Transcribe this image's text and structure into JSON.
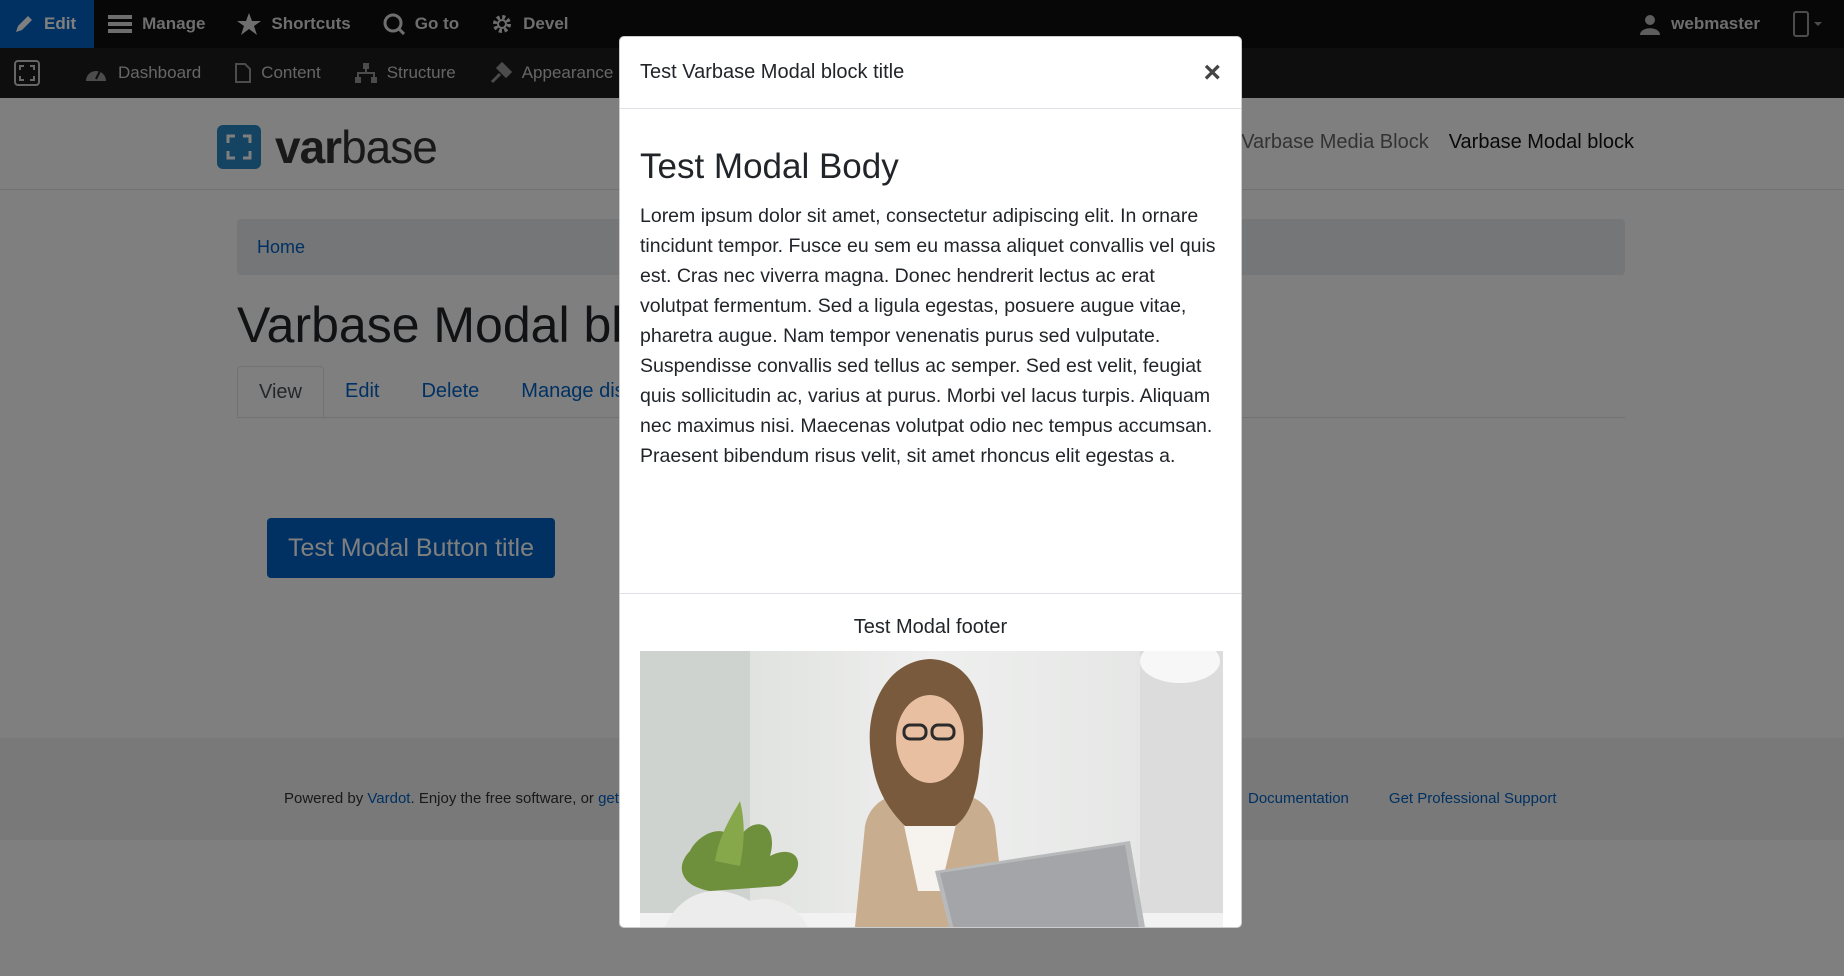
{
  "toolbar": {
    "items": [
      {
        "label": "Edit",
        "icon": "pencil-icon"
      },
      {
        "label": "Manage",
        "icon": "hamburger-icon"
      },
      {
        "label": "Shortcuts",
        "icon": "star-icon"
      },
      {
        "label": "Go to",
        "icon": "goto-icon"
      },
      {
        "label": "Devel",
        "icon": "gear-icon"
      }
    ],
    "user": "webmaster",
    "accent": "#0062c4"
  },
  "tray": {
    "items": [
      {
        "label": "Dashboard",
        "icon": "dashboard-icon"
      },
      {
        "label": "Content",
        "icon": "file-icon"
      },
      {
        "label": "Structure",
        "icon": "structure-icon"
      },
      {
        "label": "Appearance",
        "icon": "brush-icon"
      }
    ]
  },
  "site": {
    "logo_bold": "var",
    "logo_rest": "base",
    "nav": [
      "Varbase Media Block",
      "Varbase Modal block"
    ]
  },
  "page": {
    "breadcrumb": "Home",
    "title": "Varbase Modal bl",
    "tabs": [
      "View",
      "Edit",
      "Delete",
      "Manage dis"
    ],
    "button_label": "Test Modal Button title"
  },
  "footer": {
    "powered_by": "Powered by ",
    "vardot": "Vardot",
    "enjoy": ". Enjoy the free software, or ",
    "get": "get",
    "documentation": "Documentation",
    "support": "Get Professional Support"
  },
  "modal": {
    "title": "Test Varbase Modal block title",
    "close": "×",
    "body_heading": "Test Modal Body",
    "body_text": "Lorem ipsum dolor sit amet, consectetur adipiscing elit. In ornare tincidunt tempor. Fusce eu sem eu massa aliquet convallis vel quis est. Cras nec viverra magna. Donec hendrerit lectus ac erat volutpat fermentum. Sed a ligula egestas, posuere augue vitae, pharetra augue. Nam tempor venenatis purus sed vulputate. Suspendisse convallis sed tellus ac semper. Sed est velit, feugiat quis sollicitudin ac, varius at purus. Morbi vel lacus turpis. Aliquam nec maximus nisi. Maecenas volutpat odio nec tempus accumsan. Praesent bibendum risus velit, sit amet rhoncus elit egestas a.",
    "footer_caption": "Test Modal footer"
  }
}
